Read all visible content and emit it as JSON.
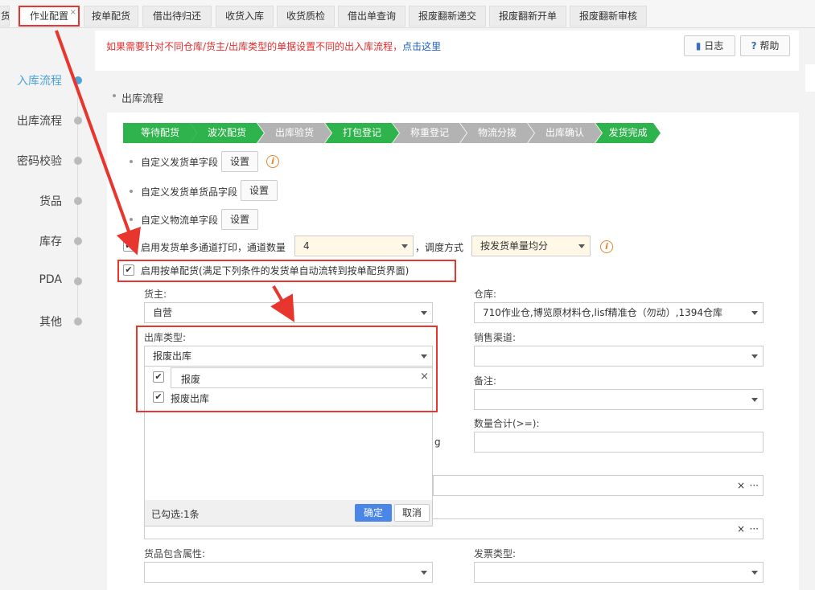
{
  "tabs": [
    {
      "label": "货"
    },
    {
      "label": "作业配置",
      "active": true,
      "close": "×"
    },
    {
      "label": "按单配货"
    },
    {
      "label": "借出待归还"
    },
    {
      "label": "收货入库"
    },
    {
      "label": "收货质检"
    },
    {
      "label": "借出单查询"
    },
    {
      "label": "报废翻新递交"
    },
    {
      "label": "报废翻新开单"
    },
    {
      "label": "报废翻新审核"
    }
  ],
  "sidebar": {
    "items": [
      {
        "label": "入库流程",
        "active": true
      },
      {
        "label": "出库流程"
      },
      {
        "label": "密码校验"
      },
      {
        "label": "货品"
      },
      {
        "label": "库存"
      },
      {
        "label": "PDA"
      },
      {
        "label": "其他"
      }
    ]
  },
  "notice": {
    "text": "如果需要针对不同仓库/货主/出库类型的单据设置不同的出入库流程，",
    "link": "点击这里",
    "log_label": "日志",
    "help_label": "帮助",
    "log_icon": "book-icon",
    "help_icon": "question-icon"
  },
  "section_title": "出库流程",
  "steps": [
    {
      "label": "等待配货",
      "state": "green"
    },
    {
      "label": "波次配货",
      "state": "green"
    },
    {
      "label": "出库验货",
      "state": "gray"
    },
    {
      "label": "打包登记",
      "state": "green"
    },
    {
      "label": "称重登记",
      "state": "gray"
    },
    {
      "label": "物流分拨",
      "state": "gray"
    },
    {
      "label": "出库确认",
      "state": "gray"
    },
    {
      "label": "发货完成",
      "state": "green"
    }
  ],
  "settings": {
    "custom_order_fields": "自定义发货单字段",
    "custom_goods_fields": "自定义发货单货品字段",
    "custom_logistics_fields": "自定义物流单字段",
    "set_label": "设置",
    "multi_channel_label": "启用发货单多通道打印，通道数量",
    "channel_count": "4",
    "dispatch_mode_label": "调度方式",
    "dispatch_mode": "按发货单量均分",
    "enable_order_picking": "启用按单配货(满足下列条件的发货单自动流转到按单配货界面)"
  },
  "filters": {
    "owner_label": "货主:",
    "owner_value": "自营",
    "warehouse_label": "仓库:",
    "warehouse_value": "710作业仓,博览原材料仓,lisf精准仓（勿动）,1394仓库",
    "outbound_type_label": "出库类型:",
    "outbound_type_value": "报废出库",
    "sales_channel_label": "销售渠道:",
    "remark_label": "备注:",
    "quantity_total_label": "数量合计(>=):",
    "goods_attr_label": "货品包含属性:",
    "invoice_type_label": "发票类型:",
    "partial_g": "g",
    "clear_glyph": "×",
    "more_glyph": "···"
  },
  "dropdown": {
    "search_value": "报废",
    "option_label": "报废出库",
    "selected_count": "已勾选:1条",
    "ok_label": "确定",
    "cancel_label": "取消"
  },
  "colors": {
    "accent": "#4da3d8",
    "step_green": "#2fb34c",
    "step_gray": "#b3b3b3",
    "annotation_red": "#e8352d",
    "notice_red": "#e52c2c",
    "warning_orange": "#e8842b"
  }
}
